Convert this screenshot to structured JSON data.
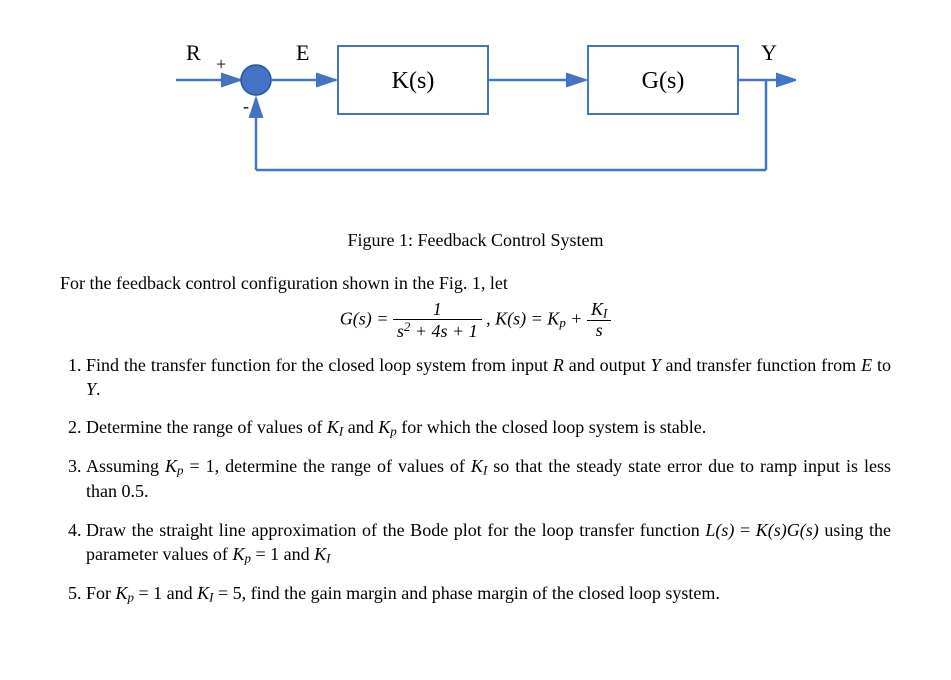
{
  "diagram": {
    "signals": {
      "R": "R",
      "E": "E",
      "Y": "Y",
      "plus": "+",
      "minus": "-"
    },
    "blocks": {
      "K": "K(s)",
      "G": "G(s)"
    }
  },
  "caption": "Figure 1: Feedback Control System",
  "intro": "For the feedback control configuration shown in the Fig. 1, let",
  "eq": {
    "G_lhs": "G(s) = ",
    "G_num": "1",
    "G_den_a": "s",
    "G_den_b": " + 4s + 1",
    "sep": ",    ",
    "K_lhs": "K(s) = K",
    "K_plus": " + ",
    "KI_top_a": "K",
    "KI_bot": "s",
    "p_sub": "p",
    "I_sub": "I"
  },
  "q": {
    "q1a": "Find the transfer function for the closed loop system from input ",
    "q1b": " and output ",
    "q1c": " and transfer function from ",
    "q1d": " to ",
    "q1e": ".",
    "R": "R",
    "Y": "Y",
    "E": "E",
    "q2a": "Determine the range of values of ",
    "q2b": " and ",
    "q2c": " for which the closed loop system is stable.",
    "KI_a": "K",
    "KI_b": "I",
    "Kp_a": "K",
    "Kp_b": "p",
    "q3a": "Assuming ",
    "q3b": " = 1, determine the range of values of ",
    "q3c": " so that the steady state error due to ramp input is less than 0.5.",
    "q4a": "Draw the straight line approximation of the Bode plot for the loop transfer function ",
    "Ls": "L(s)",
    "eqtxt": " = ",
    "KsGs": "K(s)G(s)",
    "q4b": " using the parameter values of ",
    "q4c": " = 1 and ",
    "q5a": "For ",
    "q5b": " = 1 and ",
    "q5c": " = 5, find the gain margin and phase margin of the closed loop system."
  }
}
